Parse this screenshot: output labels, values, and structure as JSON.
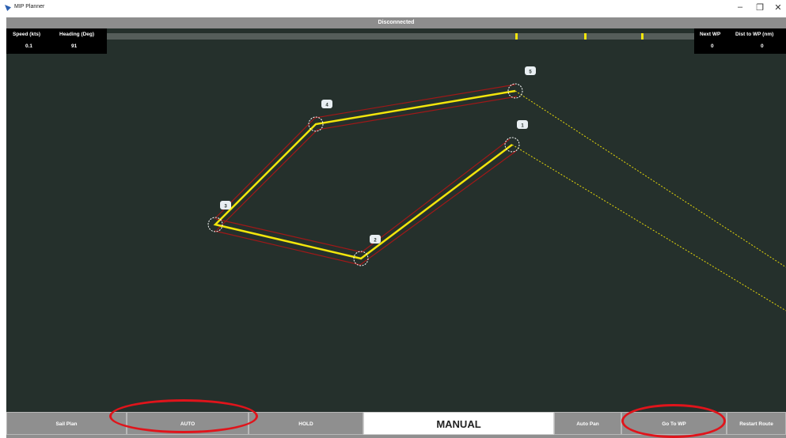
{
  "window": {
    "title": "MIP Planner",
    "minimize_glyph": "–",
    "restore_glyph": "❐",
    "close_glyph": "✕"
  },
  "status": {
    "text": "Disconnected"
  },
  "telemetry": {
    "speed_label": "Speed (kts)",
    "speed_value": "0.1",
    "heading_label": "Heading (Deg)",
    "heading_value": "91",
    "next_wp_label": "Next WP",
    "next_wp_value": "0",
    "dist_label": "Dist to WP (nm)",
    "dist_value": "0"
  },
  "waypoints": [
    {
      "label": "1"
    },
    {
      "label": "2"
    },
    {
      "label": "3"
    },
    {
      "label": "4"
    },
    {
      "label": "5"
    }
  ],
  "bottom_bar": {
    "sail_plan": "Sail Plan",
    "auto": "AUTO",
    "hold": "HOLD",
    "manual": "MANUAL",
    "auto_pan": "Auto Pan",
    "go_to_wp": "Go To WP",
    "restart_route": "Restart Route"
  },
  "colors": {
    "map": "#25302c",
    "route": "#f2e60c",
    "corridor": "#a01818",
    "highlight": "#e0141b"
  }
}
